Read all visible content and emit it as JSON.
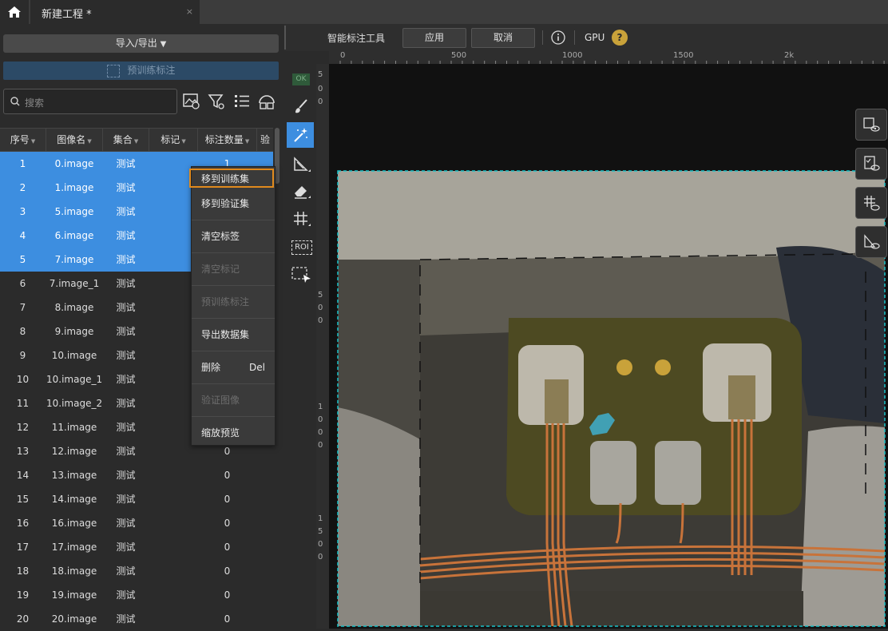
{
  "app": {
    "tab_title": "新建工程 *",
    "tab_close": "×"
  },
  "left": {
    "import_export_label": "导入/导出",
    "pretrain_label": "预训练标注",
    "search_placeholder": "搜索"
  },
  "table": {
    "columns": [
      "序号",
      "图像名",
      "集合",
      "标记",
      "标注数量",
      "验"
    ],
    "rows": [
      {
        "idx": "1",
        "name": "0.image",
        "set": "测试",
        "mark": "",
        "count": "1",
        "selected": true
      },
      {
        "idx": "2",
        "name": "1.image",
        "set": "测试",
        "mark": "",
        "count": "",
        "selected": true
      },
      {
        "idx": "3",
        "name": "5.image",
        "set": "测试",
        "mark": "",
        "count": "",
        "selected": true
      },
      {
        "idx": "4",
        "name": "6.image",
        "set": "测试",
        "mark": "",
        "count": "",
        "selected": true
      },
      {
        "idx": "5",
        "name": "7.image",
        "set": "测试",
        "mark": "",
        "count": "",
        "selected": true
      },
      {
        "idx": "6",
        "name": "7.image_1",
        "set": "测试",
        "mark": "",
        "count": "",
        "selected": false
      },
      {
        "idx": "7",
        "name": "8.image",
        "set": "测试",
        "mark": "",
        "count": "",
        "selected": false
      },
      {
        "idx": "8",
        "name": "9.image",
        "set": "测试",
        "mark": "",
        "count": "",
        "selected": false
      },
      {
        "idx": "9",
        "name": "10.image",
        "set": "测试",
        "mark": "",
        "count": "",
        "selected": false
      },
      {
        "idx": "10",
        "name": "10.image_1",
        "set": "测试",
        "mark": "",
        "count": "",
        "selected": false
      },
      {
        "idx": "11",
        "name": "10.image_2",
        "set": "测试",
        "mark": "",
        "count": "",
        "selected": false
      },
      {
        "idx": "12",
        "name": "11.image",
        "set": "测试",
        "mark": "",
        "count": "",
        "selected": false
      },
      {
        "idx": "13",
        "name": "12.image",
        "set": "测试",
        "mark": "",
        "count": "0",
        "selected": false
      },
      {
        "idx": "14",
        "name": "13.image",
        "set": "测试",
        "mark": "",
        "count": "0",
        "selected": false
      },
      {
        "idx": "15",
        "name": "14.image",
        "set": "测试",
        "mark": "",
        "count": "0",
        "selected": false
      },
      {
        "idx": "16",
        "name": "16.image",
        "set": "测试",
        "mark": "",
        "count": "0",
        "selected": false
      },
      {
        "idx": "17",
        "name": "17.image",
        "set": "测试",
        "mark": "",
        "count": "0",
        "selected": false
      },
      {
        "idx": "18",
        "name": "18.image",
        "set": "测试",
        "mark": "",
        "count": "0",
        "selected": false
      },
      {
        "idx": "19",
        "name": "19.image",
        "set": "测试",
        "mark": "",
        "count": "0",
        "selected": false
      },
      {
        "idx": "20",
        "name": "20.image",
        "set": "测试",
        "mark": "",
        "count": "0",
        "selected": false
      }
    ]
  },
  "context_menu": {
    "items": [
      {
        "label": "移到训练集",
        "shortcut": "",
        "disabled": false
      },
      {
        "label": "移到验证集",
        "shortcut": "",
        "disabled": false
      },
      {
        "label": "清空标签",
        "shortcut": "",
        "disabled": false
      },
      {
        "label": "清空标记",
        "shortcut": "",
        "disabled": true
      },
      {
        "label": "预训练标注",
        "shortcut": "",
        "disabled": true
      },
      {
        "label": "导出数据集",
        "shortcut": "",
        "disabled": false
      },
      {
        "label": "删除",
        "shortcut": "Del",
        "disabled": false
      },
      {
        "label": "验证图像",
        "shortcut": "",
        "disabled": true
      },
      {
        "label": "缩放预览",
        "shortcut": "",
        "disabled": false
      }
    ],
    "highlight_color": "#e08a1e"
  },
  "toolbar": {
    "tool_name": "智能标注工具",
    "apply_label": "应用",
    "cancel_label": "取消",
    "gpu_label": "GPU",
    "help_glyph": "?"
  },
  "tools": {
    "ok_label": "OK",
    "roi_label": "ROI"
  },
  "ruler": {
    "h_labels": [
      "0",
      "500",
      "1000",
      "1500",
      "2k"
    ],
    "v_labels": [
      "5",
      "0",
      "0",
      "5",
      "0",
      "0",
      "1",
      "0",
      "0",
      "0",
      "1",
      "5",
      "0",
      "0"
    ]
  },
  "colors": {
    "selection": "#3d8ee0",
    "accent_dashed": "#19c3c9",
    "copper": "#c8733a"
  }
}
